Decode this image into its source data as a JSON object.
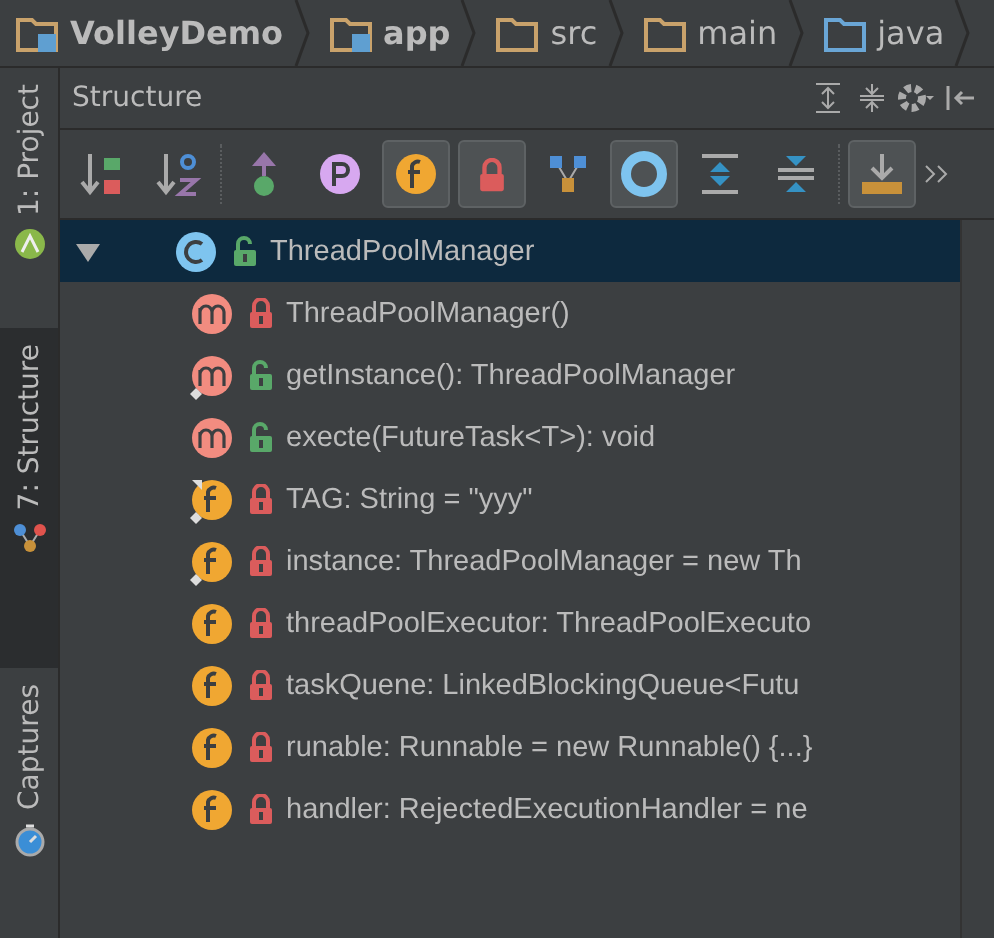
{
  "breadcrumbs": [
    {
      "label": "VolleyDemo",
      "kind": "module"
    },
    {
      "label": "app",
      "kind": "module"
    },
    {
      "label": "src",
      "kind": "folder"
    },
    {
      "label": "main",
      "kind": "folder"
    },
    {
      "label": "java",
      "kind": "source"
    }
  ],
  "side_tabs": [
    {
      "label": "1: Project",
      "kind": "project",
      "selected": false
    },
    {
      "label": "7: Structure",
      "kind": "structure",
      "selected": true
    },
    {
      "label": "Captures",
      "kind": "captures",
      "selected": false
    }
  ],
  "panel": {
    "title": "Structure"
  },
  "toolbar": [
    {
      "kind": "sort-visibility",
      "selected": false
    },
    {
      "kind": "sort-alpha",
      "selected": false
    },
    {
      "kind": "sep"
    },
    {
      "kind": "inherited",
      "selected": false
    },
    {
      "kind": "properties",
      "selected": false
    },
    {
      "kind": "fields",
      "selected": true
    },
    {
      "kind": "non-public",
      "selected": true
    },
    {
      "kind": "anonymous",
      "selected": false
    },
    {
      "kind": "lambdas",
      "selected": true
    },
    {
      "kind": "expand",
      "selected": false
    },
    {
      "kind": "collapse",
      "selected": false
    },
    {
      "kind": "sep"
    },
    {
      "kind": "autoscroll",
      "selected": true
    },
    {
      "kind": "more"
    }
  ],
  "tree": {
    "label": "ThreadPoolManager",
    "kind": "class",
    "public": true,
    "expanded": true,
    "selected": true,
    "children": [
      {
        "label": "ThreadPoolManager()",
        "kind": "method",
        "public": false,
        "static": false,
        "final": false,
        "selected": false
      },
      {
        "label": "getInstance(): ThreadPoolManager",
        "kind": "method",
        "public": true,
        "static": true,
        "final": false,
        "selected": false
      },
      {
        "label": "execte(FutureTask<T>): void",
        "kind": "method",
        "public": true,
        "static": false,
        "final": false,
        "selected": false
      },
      {
        "label": "TAG: String = \"yyy\"",
        "kind": "field",
        "public": false,
        "static": true,
        "final": true,
        "selected": false
      },
      {
        "label": "instance: ThreadPoolManager = new Th",
        "kind": "field",
        "public": false,
        "static": true,
        "final": false,
        "selected": false
      },
      {
        "label": "threadPoolExecutor: ThreadPoolExecuto",
        "kind": "field",
        "public": false,
        "static": false,
        "final": false,
        "selected": false
      },
      {
        "label": "taskQuene: LinkedBlockingQueue<Futu",
        "kind": "field",
        "public": false,
        "static": false,
        "final": false,
        "selected": false
      },
      {
        "label": "runable: Runnable = new Runnable() {...}",
        "kind": "field",
        "public": false,
        "static": false,
        "final": false,
        "selected": false
      },
      {
        "label": "handler: RejectedExecutionHandler = ne",
        "kind": "field",
        "public": false,
        "static": false,
        "final": false,
        "selected": false
      }
    ]
  }
}
